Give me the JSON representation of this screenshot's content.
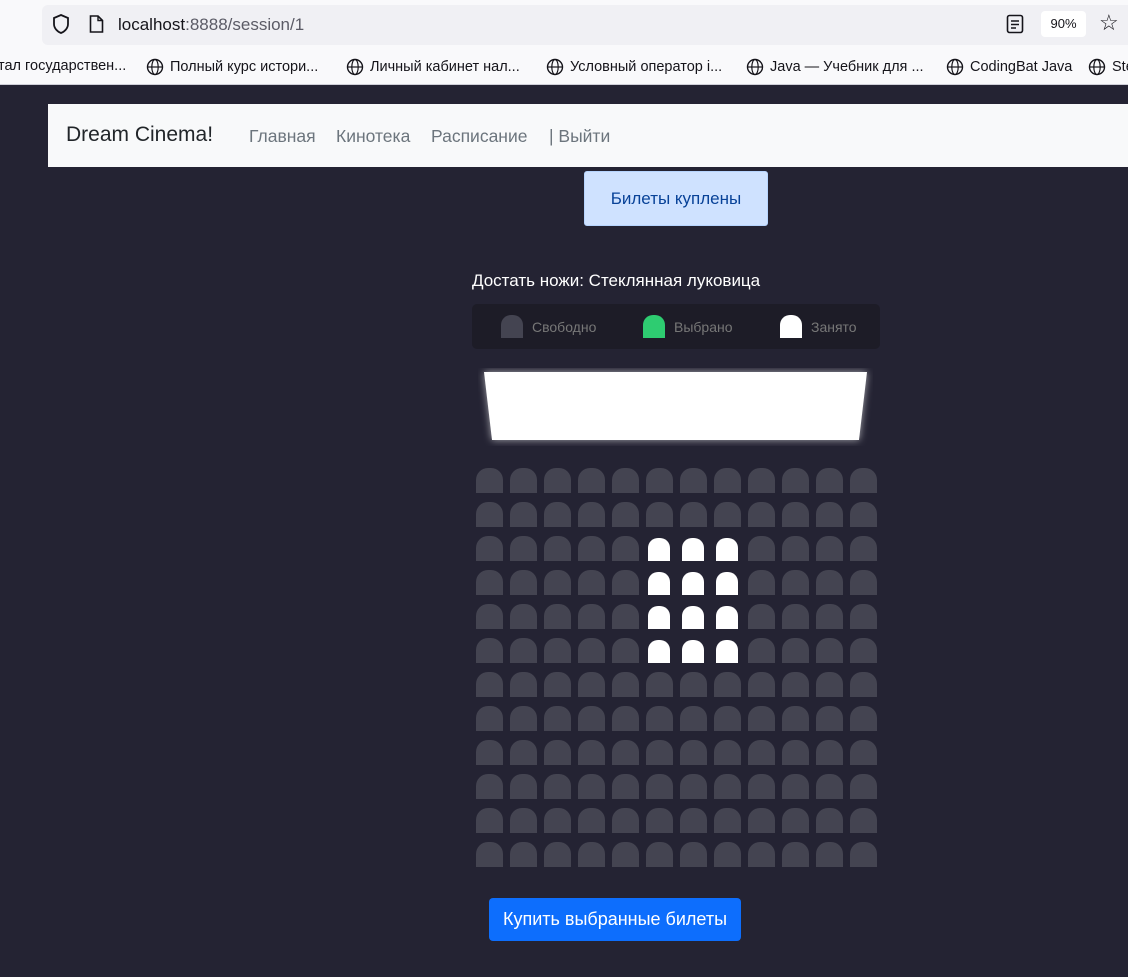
{
  "browser": {
    "url_host": "localhost",
    "url_path": ":8888/session/1",
    "zoom": "90%",
    "bookmarks": [
      "тал государствен...",
      "Полный курс истори...",
      "Личный кабинет нал...",
      "Условный оператор i...",
      "Java — Учебник для ...",
      "CodingBat Java",
      "Ste"
    ]
  },
  "navbar": {
    "brand": "Dream Cinema!",
    "links": [
      "Главная",
      "Кинотека",
      "Расписание",
      "| Выйти"
    ]
  },
  "alert": "Билеты куплены",
  "movie_title": "Достать ножи: Стеклянная луковица",
  "legend": {
    "free": "Свободно",
    "selected": "Выбрано",
    "occupied": "Занято"
  },
  "colors": {
    "free": "#444451",
    "selected": "#2ecc71",
    "occupied": "#ffffff",
    "background": "#242333",
    "primary": "#0d6efd"
  },
  "seating": {
    "rows": 12,
    "cols": 12,
    "occupied": [
      [
        2,
        5
      ],
      [
        2,
        6
      ],
      [
        2,
        7
      ],
      [
        3,
        5
      ],
      [
        3,
        6
      ],
      [
        3,
        7
      ],
      [
        4,
        5
      ],
      [
        4,
        6
      ],
      [
        4,
        7
      ],
      [
        5,
        5
      ],
      [
        5,
        6
      ],
      [
        5,
        7
      ]
    ]
  },
  "buy_button": "Купить выбранные билеты"
}
